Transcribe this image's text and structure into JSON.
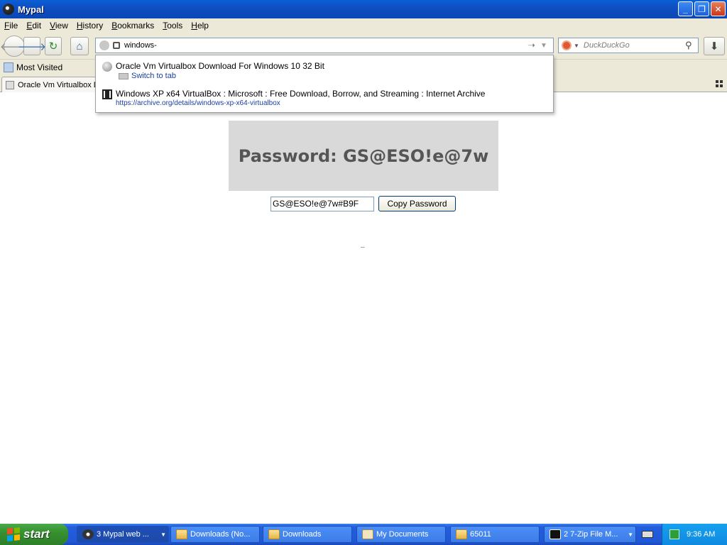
{
  "window": {
    "title": "Mypal"
  },
  "menu": [
    "File",
    "Edit",
    "View",
    "History",
    "Bookmarks",
    "Tools",
    "Help"
  ],
  "urlbar": {
    "value": "windows-"
  },
  "search": {
    "placeholder": "DuckDuckGo"
  },
  "bookmarks": {
    "most_visited": "Most Visited"
  },
  "tab": {
    "label": "Oracle Vm Virtualbox Download For Windows 10 32 Bit"
  },
  "autocomplete": [
    {
      "title": "Oracle Vm Virtualbox Download For Windows 10 32 Bit",
      "sub": "Switch to tab"
    },
    {
      "title": "Windows XP x64 VirtualBox : Microsoft : Free Download, Borrow, and Streaming : Internet Archive",
      "sub": "https://archive.org/details/windows-xp-x64-virtualbox"
    }
  ],
  "page": {
    "password_heading": "Password: GS@ESO!e@7w",
    "password_field": "GS@ESO!e@7w#B9F",
    "copy_button": "Copy Password",
    "dash": "–"
  },
  "taskbar": {
    "start": "start",
    "tasks": [
      "3 Mypal web ...",
      "Downloads (No...",
      "Downloads",
      "My Documents",
      "65011",
      "2 7-Zip File M..."
    ],
    "clock": "9:36 AM"
  }
}
